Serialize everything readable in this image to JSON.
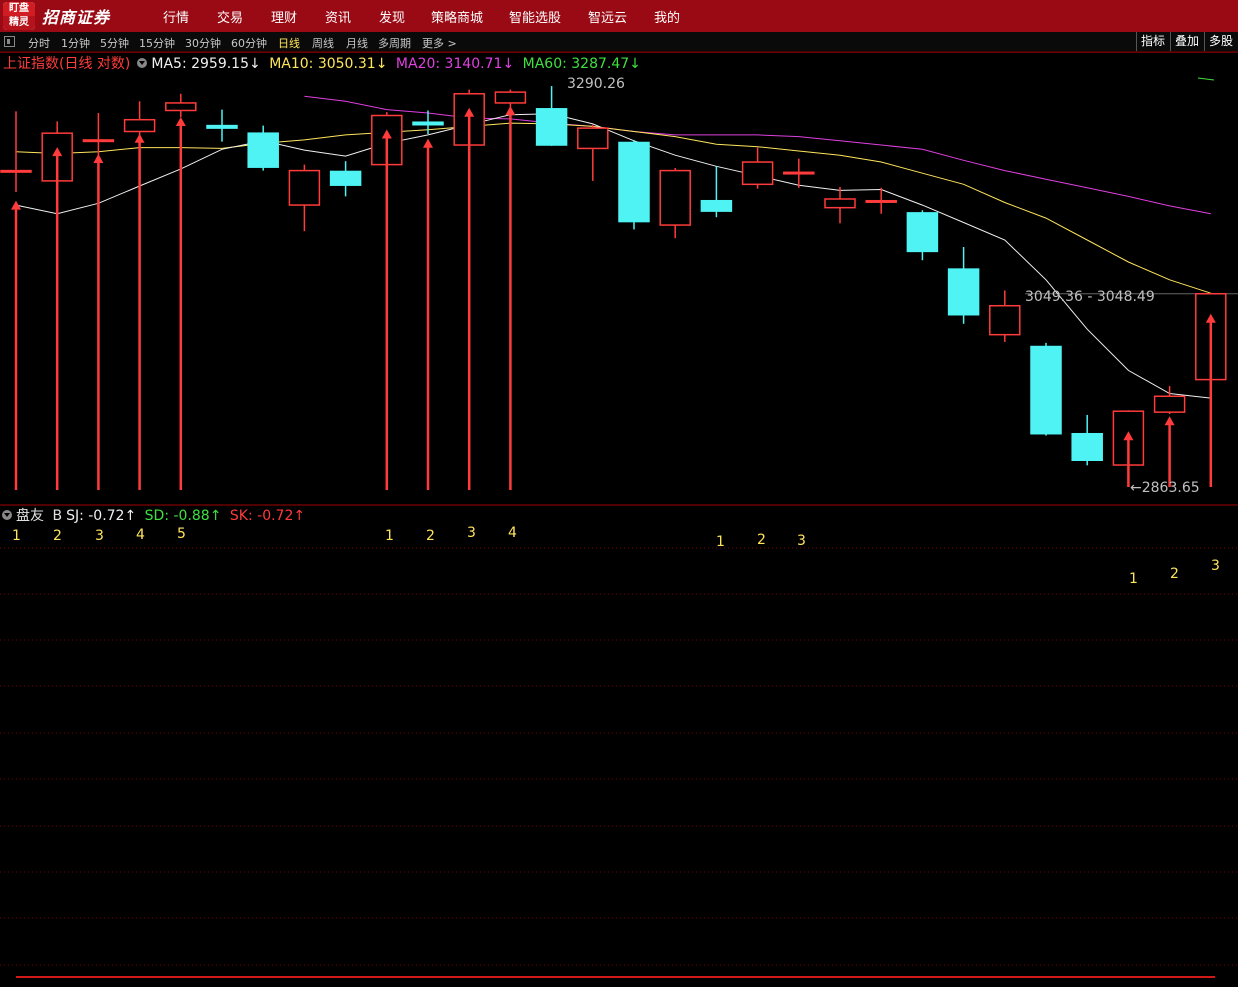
{
  "menu": {
    "logo_top": "盯盘",
    "logo_bottom": "精灵",
    "brand": "招商证券",
    "items": [
      "行情",
      "交易",
      "理财",
      "资讯",
      "发现",
      "策略商城",
      "智能选股",
      "智远云",
      "我的"
    ]
  },
  "toolbar": {
    "periods": [
      "分时",
      "1分钟",
      "5分钟",
      "15分钟",
      "30分钟",
      "60分钟",
      "日线",
      "周线",
      "月线",
      "多周期",
      "更多 >"
    ],
    "active_period": "日线",
    "right_buttons": [
      "指标",
      "叠加",
      "多股"
    ]
  },
  "main_legend": {
    "title": "上证指数(日线 对数)",
    "ma5": "MA5: 2959.15↓",
    "ma10": "MA10: 3050.31↓",
    "ma20": "MA20: 3140.71↓",
    "ma60": "MA60: 3287.47↓"
  },
  "sub_legend": {
    "name": "盘友",
    "b_label": "B",
    "sj": "SJ: -0.72↑",
    "sd": "SD: -0.88↑",
    "sk": "SK: -0.72↑"
  },
  "annotations": {
    "high": "3290.26",
    "current": "3049.36 - 3048.49",
    "low": "2863.65",
    "signal_numbers": [
      "1",
      "2",
      "3",
      "4",
      "5",
      "1",
      "2",
      "3",
      "4",
      "1",
      "2",
      "3",
      "1",
      "2",
      "3"
    ]
  },
  "colors": {
    "up": "#ff3b3b",
    "down": "#4ff3f3",
    "ma5": "#f0f0f0",
    "ma10": "#ffe55c",
    "ma20": "#e040e0",
    "ma60": "#40e040",
    "grid": "#7a0000",
    "menu_bg": "#9a0a14"
  },
  "chart_data": {
    "type": "candlestick",
    "title": "上证指数(日线 对数)",
    "candles": [
      {
        "o": 3190.0,
        "c": 3190.0,
        "h": 3260.0,
        "l": 3165.0
      },
      {
        "o": 3178.0,
        "c": 3234.0,
        "h": 3248.0,
        "l": 3166.0
      },
      {
        "o": 3226.0,
        "c": 3226.0,
        "h": 3258.0,
        "l": 3200.0
      },
      {
        "o": 3236.0,
        "c": 3250.0,
        "h": 3272.0,
        "l": 3204.0
      },
      {
        "o": 3261.0,
        "c": 3270.0,
        "h": 3281.0,
        "l": 3253.0
      },
      {
        "o": 3243.0,
        "c": 3240.0,
        "h": 3262.0,
        "l": 3224.0
      },
      {
        "o": 3234.0,
        "c": 3194.0,
        "h": 3243.0,
        "l": 3190.0
      },
      {
        "o": 3150.0,
        "c": 3190.0,
        "h": 3197.0,
        "l": 3120.0
      },
      {
        "o": 3189.0,
        "c": 3173.0,
        "h": 3201.0,
        "l": 3160.0
      },
      {
        "o": 3197.0,
        "c": 3255.0,
        "h": 3259.0,
        "l": 3192.0
      },
      {
        "o": 3247.0,
        "c": 3244.0,
        "h": 3261.0,
        "l": 3233.0
      },
      {
        "o": 3220.0,
        "c": 3281.0,
        "h": 3286.0,
        "l": 3218.0
      },
      {
        "o": 3270.0,
        "c": 3283.0,
        "h": 3286.0,
        "l": 3262.0
      },
      {
        "o": 3263.0,
        "c": 3220.0,
        "h": 3290.26,
        "l": 3219.0
      },
      {
        "o": 3216.0,
        "c": 3240.0,
        "h": 3244.0,
        "l": 3178.0
      },
      {
        "o": 3223.0,
        "c": 3131.0,
        "h": 3226.0,
        "l": 3122.0
      },
      {
        "o": 3127.0,
        "c": 3190.0,
        "h": 3193.0,
        "l": 3112.0
      },
      {
        "o": 3155.0,
        "c": 3143.0,
        "h": 3195.0,
        "l": 3136.0
      },
      {
        "o": 3174.0,
        "c": 3200.0,
        "h": 3217.0,
        "l": 3169.0
      },
      {
        "o": 3188.0,
        "c": 3188.0,
        "h": 3204.0,
        "l": 3170.0
      },
      {
        "o": 3147.0,
        "c": 3157.0,
        "h": 3171.0,
        "l": 3129.0
      },
      {
        "o": 3155.0,
        "c": 3155.0,
        "h": 3170.0,
        "l": 3140.0
      },
      {
        "o": 3141.0,
        "c": 3097.0,
        "h": 3144.0,
        "l": 3087.0
      },
      {
        "o": 3077.0,
        "c": 3026.0,
        "h": 3102.0,
        "l": 3016.0
      },
      {
        "o": 3004.0,
        "c": 3036.0,
        "h": 3053.0,
        "l": 2996.0
      },
      {
        "o": 2991.0,
        "c": 2897.0,
        "h": 2995.0,
        "l": 2895.0
      },
      {
        "o": 2897.0,
        "c": 2869.0,
        "h": 2917.0,
        "l": 2863.65
      },
      {
        "o": 2864.0,
        "c": 2921.0,
        "h": 2922.0,
        "l": 2863.65
      },
      {
        "o": 2920.0,
        "c": 2937.0,
        "h": 2948.0,
        "l": 2918.0
      },
      {
        "o": 2955.0,
        "c": 3049.36,
        "h": 3049.36,
        "l": 2954.0
      }
    ],
    "ma5": [
      3150,
      3140,
      3152,
      3172,
      3192,
      3215,
      3225,
      3214,
      3207,
      3222,
      3232,
      3244,
      3256,
      3257,
      3245,
      3225,
      3208,
      3195,
      3184,
      3173,
      3167,
      3168,
      3150,
      3130,
      3110,
      3065,
      3010,
      2965,
      2940,
      2935
    ],
    "ma10": [
      3212,
      3210,
      3212,
      3217,
      3217,
      3216,
      3222,
      3226,
      3232,
      3235,
      3238,
      3242,
      3246,
      3245,
      3242,
      3236,
      3230,
      3221,
      3218,
      3213,
      3208,
      3200,
      3187,
      3174,
      3153,
      3135,
      3110,
      3085,
      3065,
      3050
    ],
    "ma20": [
      null,
      null,
      null,
      null,
      null,
      null,
      null,
      3278,
      3272,
      3262,
      3258,
      3252,
      3251,
      3246,
      3242,
      3236,
      3232,
      3232,
      3232,
      3230,
      3225,
      3220,
      3215,
      3202,
      3190,
      3180,
      3170,
      3160,
      3149,
      3140
    ],
    "signals_main": [
      0,
      1,
      2,
      3,
      4,
      9,
      10,
      11,
      12
    ],
    "signals_main_late": [
      27,
      28,
      29
    ]
  }
}
